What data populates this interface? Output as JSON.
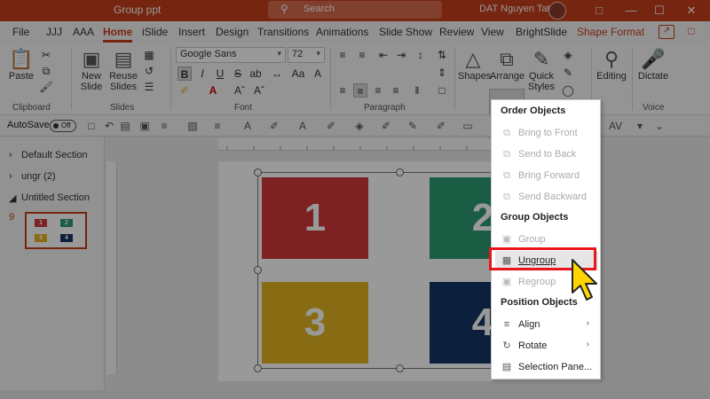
{
  "titlebar": {
    "doc_title": "Group ppt",
    "search_placeholder": "Search",
    "user_name": "DAT Nguyen Tat",
    "minimize": "—",
    "restore": "☐",
    "close": "✕"
  },
  "tabs": {
    "items": [
      "File",
      "JJJ",
      "AAA",
      "Home",
      "iSlide",
      "Insert",
      "Design",
      "Transitions",
      "Animations",
      "Slide Show",
      "Review",
      "View",
      "BrightSlide",
      "Shape Format"
    ],
    "active": "Home"
  },
  "ribbon": {
    "paste_label": "Paste",
    "clipboard_label": "Clipboard",
    "new_slide_label": "New Slide",
    "reuse_slides_label": "Reuse Slides",
    "slides_label": "Slides",
    "font_name": "Google Sans",
    "font_size": "72",
    "font_label": "Font",
    "paragraph_label": "Paragraph",
    "shapes_label": "Shapes",
    "arrange_label": "Arrange",
    "quick_styles_label": "Quick Styles",
    "editing_label": "Editing",
    "dictate_label": "Dictate",
    "voice_label": "Voice",
    "bold": "B",
    "italic": "I"
  },
  "format_toolbar": {
    "autosave_label": "AutoSave",
    "autosave_state": "Off"
  },
  "sections": {
    "default": "Default Section",
    "ungr": "ungr (2)",
    "untitled": "Untitled Section",
    "slide_number": "9"
  },
  "slide": {
    "tiles": [
      "1",
      "2",
      "3",
      "4"
    ]
  },
  "arrange_menu": {
    "order_header": "Order Objects",
    "bring_to_front": "Bring to Front",
    "send_to_back": "Send to Back",
    "bring_forward": "Bring Forward",
    "send_backward": "Send Backward",
    "group_header": "Group Objects",
    "group": "Group",
    "ungroup": "Ungroup",
    "regroup": "Regroup",
    "position_header": "Position Objects",
    "align": "Align",
    "rotate": "Rotate",
    "selection_pane": "Selection Pane..."
  },
  "colors": {
    "accent": "#c43e1c",
    "tile_red": "#d0383a",
    "tile_green": "#2e9a73",
    "tile_yellow": "#e3b422",
    "tile_navy": "#143565",
    "highlight_box": "#e8151d",
    "cursor": "#ffd400"
  }
}
